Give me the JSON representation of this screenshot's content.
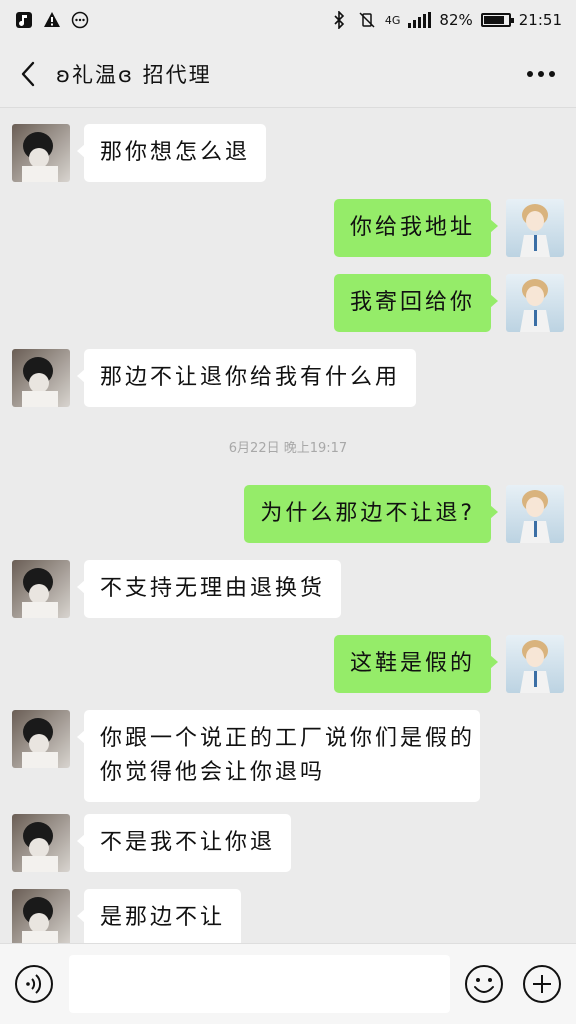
{
  "status_bar": {
    "left_icons": [
      "music-app-icon",
      "warning-icon",
      "more-notifications-icon"
    ],
    "network": "4G",
    "battery_percent": "82%",
    "battery_level": 0.82,
    "time": "21:51"
  },
  "header": {
    "title": "ʚ礼温ɞ 招代理"
  },
  "messages": [
    {
      "side": "in",
      "text": "那你想怎么退"
    },
    {
      "side": "out",
      "text": "你给我地址"
    },
    {
      "side": "out",
      "text": "我寄回给你"
    },
    {
      "side": "in",
      "text": "那边不让退你给我有什么用"
    },
    {
      "side": "out",
      "text": "为什么那边不让退?"
    },
    {
      "side": "in",
      "text": "不支持无理由退换货"
    },
    {
      "side": "out",
      "text": "这鞋是假的"
    },
    {
      "side": "in",
      "text_line1": "你跟一个说正的工厂说你们是假的",
      "text_line2": "你觉得他会让你退吗"
    },
    {
      "side": "in",
      "text": "不是我不让你退"
    },
    {
      "side": "in",
      "text": "是那边不让"
    }
  ],
  "timestamp": "6月22日 晚上19:17",
  "input": {
    "value": "",
    "placeholder": ""
  }
}
